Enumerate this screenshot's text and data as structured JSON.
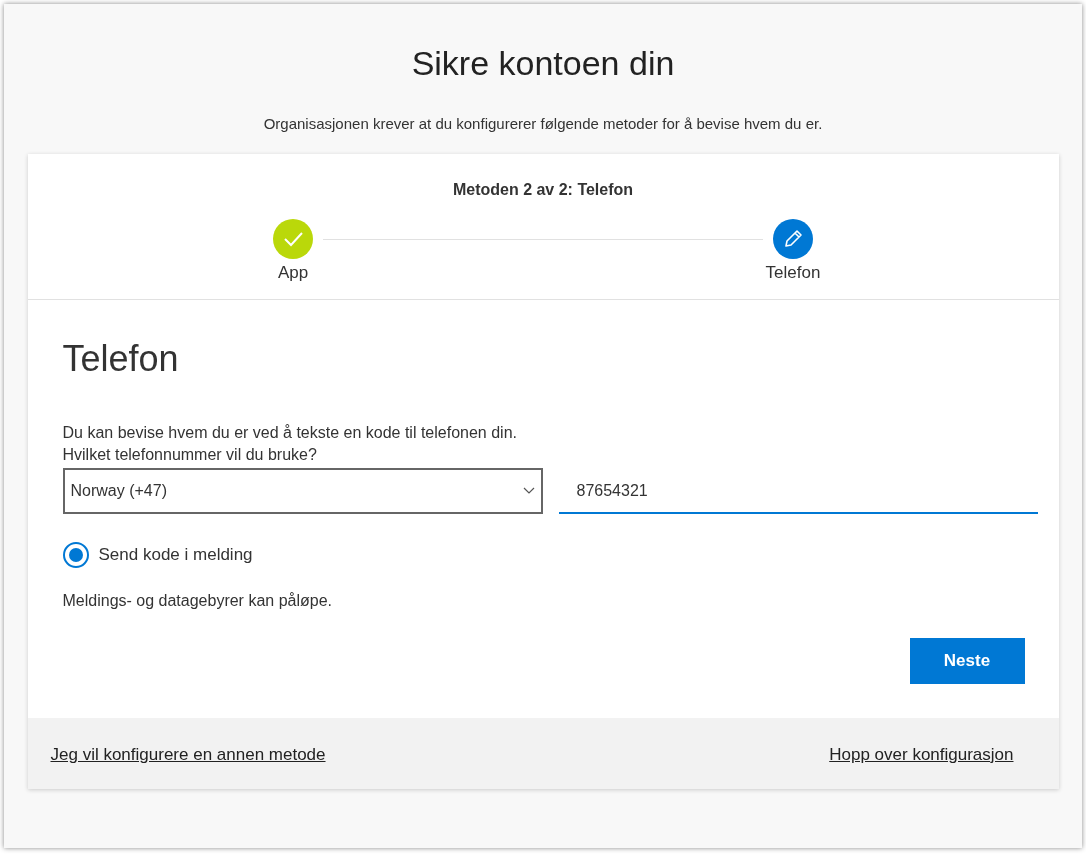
{
  "title": "Sikre kontoen din",
  "subtitle": "Organisasjonen krever at du konfigurerer følgende metoder for å bevise hvem du er.",
  "progress": {
    "heading": "Metoden 2 av 2: Telefon",
    "steps": [
      {
        "label": "App",
        "kind": "done"
      },
      {
        "label": "Telefon",
        "kind": "current"
      }
    ]
  },
  "section": {
    "heading": "Telefon",
    "description": "Du kan bevise hvem du er ved å tekste en kode til telefonen din.",
    "question": "Hvilket telefonnummer vil du bruke?",
    "country": {
      "value": "Norway (+47)"
    },
    "phone": {
      "value": "87654321"
    },
    "options": [
      {
        "label": "Send kode i melding",
        "selected": true
      }
    ],
    "note": "Meldings- og datagebyrer kan påløpe.",
    "next_button": "Neste"
  },
  "footer": {
    "left_link": "Jeg vil konfigurere en annen metode",
    "right_link": "Hopp over konfigurasjon"
  }
}
